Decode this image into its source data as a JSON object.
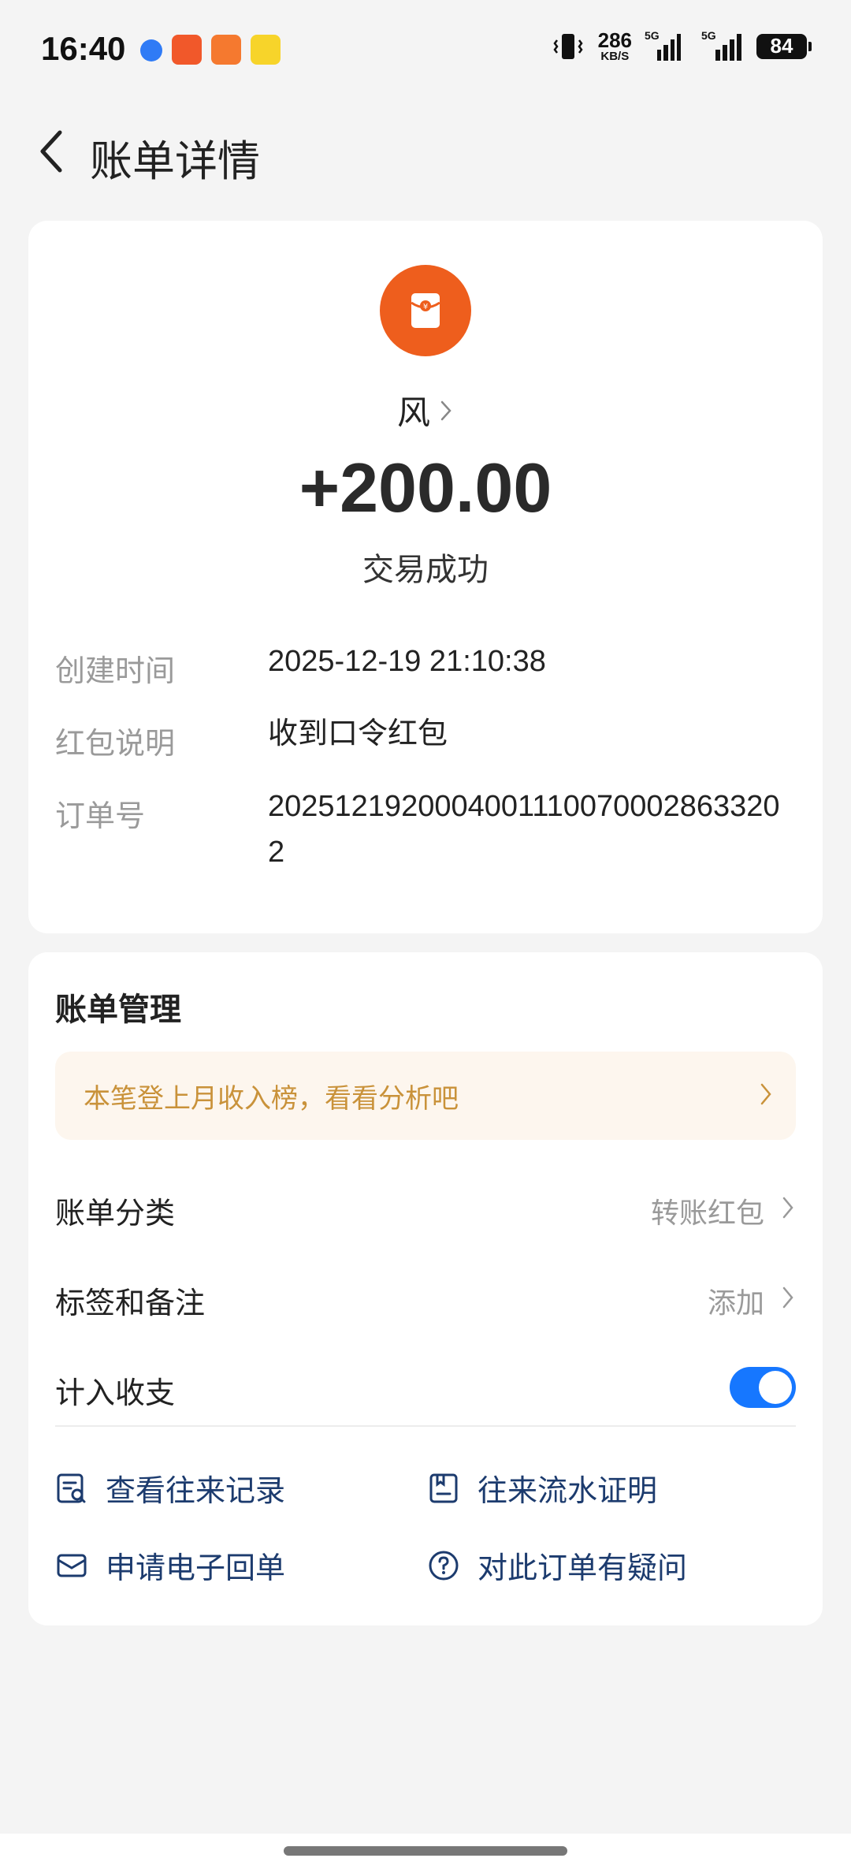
{
  "status_bar": {
    "time": "16:40",
    "net_speed": "286",
    "net_unit": "KB/S",
    "sig1_tag": "5G",
    "sig2_tag": "5G",
    "battery": "84",
    "app_icon_colors": [
      "#2f7bf6",
      "#f1582a",
      "#f5792f",
      "#f7d42a"
    ]
  },
  "header": {
    "title": "账单详情",
    "back_icon": "chevron-left-icon"
  },
  "summary": {
    "payer_name": "风",
    "amount": "+200.00",
    "status": "交易成功",
    "avatar_color": "#ee5e1d",
    "avatar_icon": "red-envelope-icon"
  },
  "details": [
    {
      "key": "创建时间",
      "value": "2025-12-19 21:10:38"
    },
    {
      "key": "红包说明",
      "value": "收到口令红包"
    },
    {
      "key": "订单号",
      "value": "20251219200040011100700028633202"
    }
  ],
  "management": {
    "title": "账单管理",
    "banner_text": "本笔登上月收入榜，看看分析吧",
    "category_label": "账单分类",
    "category_value": "转账红包",
    "tags_label": "标签和备注",
    "tags_value": "添加",
    "include_label": "计入收支",
    "include_enabled": true,
    "accent": "#1677ff"
  },
  "links": {
    "history": "查看往来记录",
    "statement": "往来流水证明",
    "receipt": "申请电子回单",
    "question": "对此订单有疑问"
  }
}
